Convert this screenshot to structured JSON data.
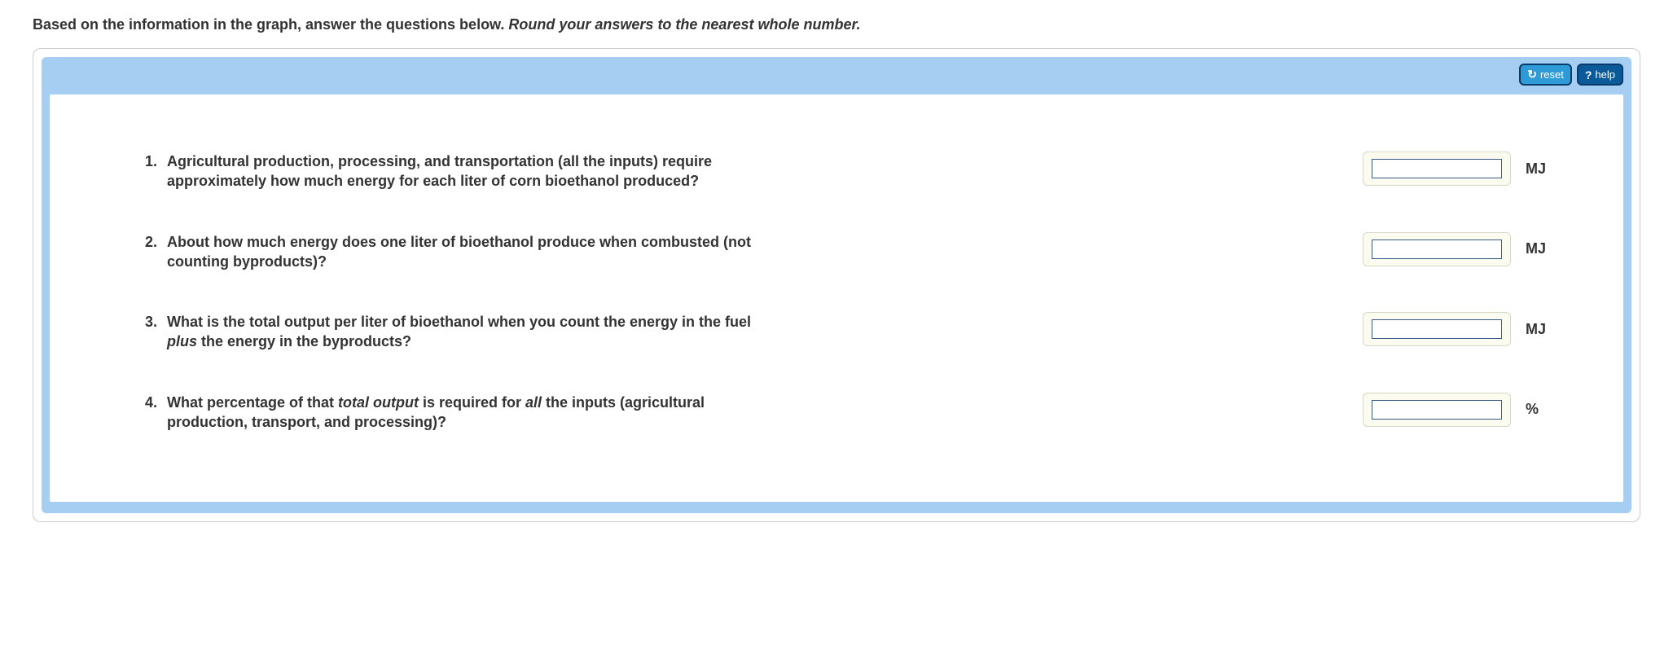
{
  "instruction": {
    "plain": "Based on the information in the graph, answer the questions below. ",
    "italic": "Round your answers to the nearest whole number."
  },
  "toolbar": {
    "reset_label": "reset",
    "help_label": "help"
  },
  "questions": [
    {
      "num": "1.",
      "text": "Agricultural production, processing, and transportation (all the inputs) require approximately how much energy for each liter of corn bioethanol produced?",
      "unit": "MJ",
      "value": ""
    },
    {
      "num": "2.",
      "text": "About how much energy does one liter of bioethanol produce when combusted (not counting byproducts)?",
      "unit": "MJ",
      "value": ""
    },
    {
      "num": "3.",
      "text_html": "What is the total output per liter of bioethanol when you count the energy in the fuel <em>plus</em> the energy in the byproducts?",
      "unit": "MJ",
      "value": ""
    },
    {
      "num": "4.",
      "text_html": "What percentage of that <em>total output</em> is required for <em>all</em> the inputs (agricultural production, transport, and processing)?",
      "unit": "%",
      "value": ""
    }
  ]
}
